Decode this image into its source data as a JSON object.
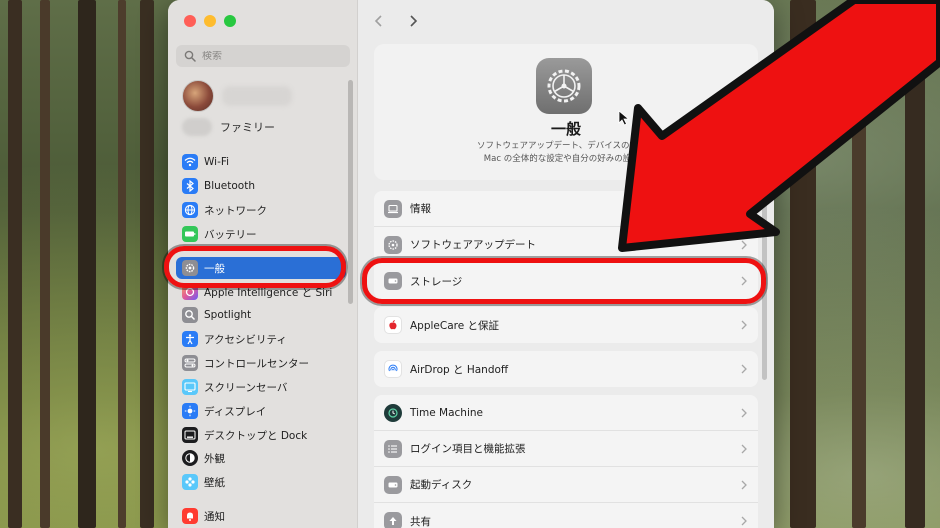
{
  "search": {
    "placeholder": "検索"
  },
  "account": {
    "family_label": "ファミリー"
  },
  "sidebar": {
    "items": [
      {
        "label": "Wi-Fi",
        "color": "#2a7cf6"
      },
      {
        "label": "Bluetooth",
        "color": "#2a7cf6"
      },
      {
        "label": "ネットワーク",
        "color": "#2a7cf6"
      },
      {
        "label": "バッテリー",
        "color": "#34c759"
      },
      {
        "label": "一般",
        "color": "#8e8e93"
      },
      {
        "label": "Apple Intelligence と Siri",
        "color": "#e05a9a"
      },
      {
        "label": "Spotlight",
        "color": "#8e8e93"
      },
      {
        "label": "アクセシビリティ",
        "color": "#2a7cf6"
      },
      {
        "label": "コントロールセンター",
        "color": "#8e8e93"
      },
      {
        "label": "スクリーンセーバ",
        "color": "#5ac8fa"
      },
      {
        "label": "ディスプレイ",
        "color": "#2a7cf6"
      },
      {
        "label": "デスクトップと Dock",
        "color": "#1c1c1e"
      },
      {
        "label": "外観",
        "color": "#1c1c1e"
      },
      {
        "label": "壁紙",
        "color": "#5ac8fa"
      },
      {
        "label": "通知",
        "color": "#ff3b30"
      }
    ],
    "selected_index": 4
  },
  "hero": {
    "title": "一般",
    "desc_line1": "ソフトウェアアップデート、デバイスの言語、",
    "desc_line2": "Mac の全体的な設定や自分の好みの設定を"
  },
  "rows": [
    {
      "label": "情報"
    },
    {
      "label": "ソフトウェアアップデート"
    },
    {
      "label": "ストレージ"
    },
    {
      "label": "AppleCare と保証"
    },
    {
      "label": "AirDrop と Handoff"
    },
    {
      "label": "Time Machine"
    },
    {
      "label": "ログイン項目と機能拡張"
    },
    {
      "label": "起動ディスク"
    },
    {
      "label": "共有"
    }
  ],
  "colors": {
    "accent": "#2a6fd6",
    "highlight": "#ee1111",
    "arrow": "#ee1111"
  }
}
